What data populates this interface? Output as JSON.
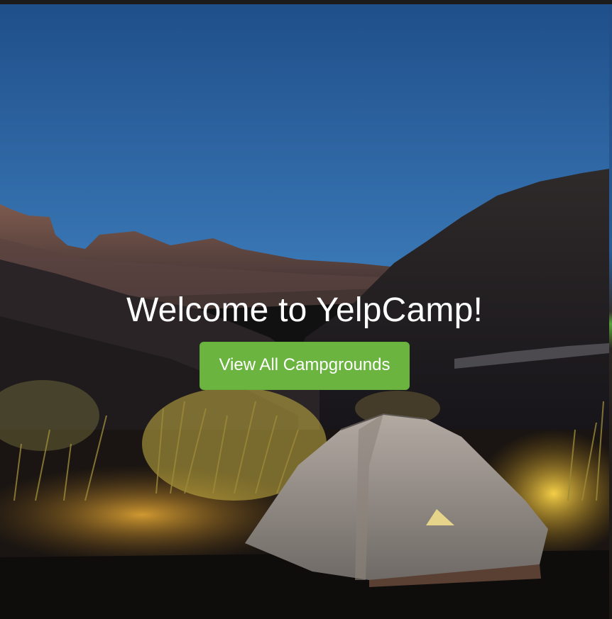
{
  "hero": {
    "title": "Welcome to YelpCamp!",
    "cta_label": "View All Campgrounds",
    "background_image": "night-camping-tent-under-canyon-cliffs",
    "accent_color": "#6ab43f"
  }
}
